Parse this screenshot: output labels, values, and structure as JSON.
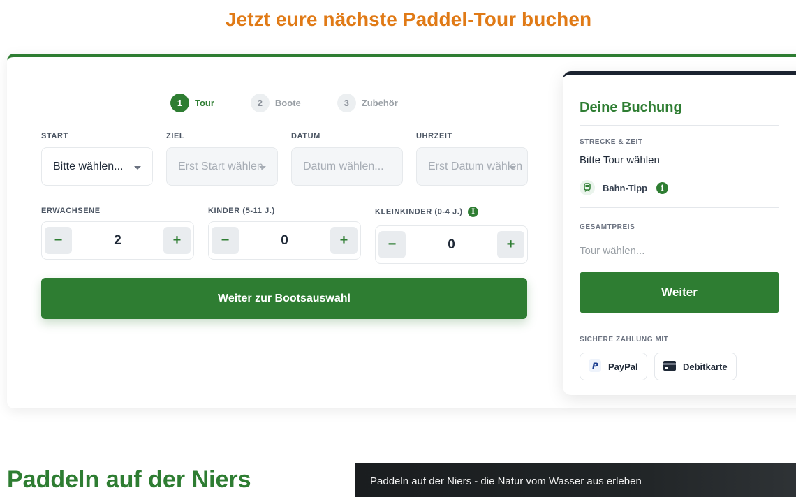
{
  "page": {
    "heading": "Jetzt eure nächste Paddel-Tour buchen"
  },
  "stepper": {
    "steps": [
      {
        "num": "1",
        "label": "Tour"
      },
      {
        "num": "2",
        "label": "Boote"
      },
      {
        "num": "3",
        "label": "Zubehör"
      }
    ]
  },
  "form": {
    "start": {
      "label": "START",
      "value": "Bitte wählen..."
    },
    "ziel": {
      "label": "ZIEL",
      "value": "Erst Start wählen"
    },
    "datum": {
      "label": "DATUM",
      "value": "Datum wählen..."
    },
    "uhrzeit": {
      "label": "UHRZEIT",
      "value": "Erst Datum wählen"
    },
    "erwachsene": {
      "label": "ERWACHSENE",
      "value": "2"
    },
    "kinder": {
      "label": "KINDER (5-11 J.)",
      "value": "0"
    },
    "kleinkinder": {
      "label": "KLEINKINDER (0-4 J.)",
      "value": "0"
    },
    "minus": "−",
    "plus": "+",
    "info_glyph": "i",
    "submit_label": "Weiter zur Bootsauswahl"
  },
  "summary": {
    "title": "Deine Buchung",
    "route_label": "STRECKE & ZEIT",
    "route_value": "Bitte Tour wählen",
    "bahn_label": "Bahn-Tipp",
    "price_label": "GESAMTPREIS",
    "price_value": "Tour wählen...",
    "weiter_label": "Weiter",
    "payment_label": "SICHERE ZAHLUNG MIT",
    "payments": [
      {
        "label": "PayPal"
      },
      {
        "label": "Debitkarte"
      }
    ]
  },
  "section": {
    "title": "Paddeln auf der Niers",
    "video_title": "Paddeln auf der Niers - die Natur vom Wasser aus erleben"
  },
  "colors": {
    "accent": "#2e7d32",
    "heading": "#e07a16",
    "summary_border": "#1b2330"
  }
}
